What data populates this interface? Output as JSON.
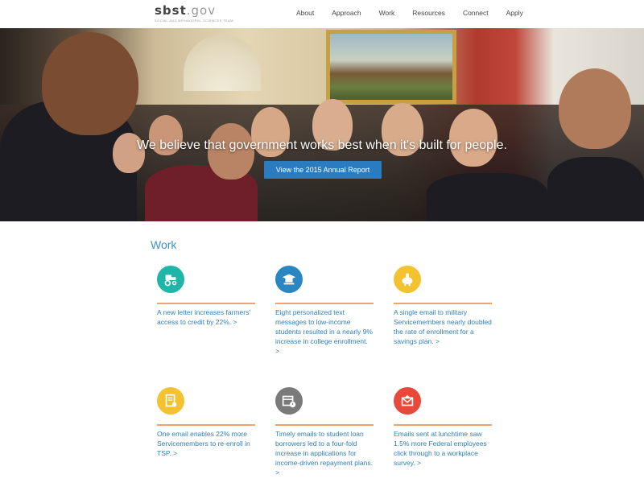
{
  "header": {
    "logo_main": "sbst",
    "logo_suffix": ".gov",
    "logo_sub": "Social and Behavioral Sciences Team",
    "nav": [
      "About",
      "Approach",
      "Work",
      "Resources",
      "Connect",
      "Apply"
    ]
  },
  "hero": {
    "tagline": "We believe that government works best when it's built for people.",
    "cta": "View the 2015 Annual Report"
  },
  "work": {
    "title": "Work",
    "cards": [
      {
        "icon": "tractor-icon",
        "color": "#1fb5a8",
        "text": "A new letter increases farmers' access to credit by 22%. >"
      },
      {
        "icon": "graduation-icon",
        "color": "#2a86c0",
        "text": "Eight personalized text messages to low-income students resulted in a nearly 9% increase in college enrollment. >"
      },
      {
        "icon": "piggy-bank-icon",
        "color": "#f2c230",
        "text": "A single email to military Servicemembers nearly doubled the rate of enrollment for a savings plan. >"
      },
      {
        "icon": "document-icon",
        "color": "#f2c230",
        "text": "One email enables 22% more Servicemembers to re-enroll in TSP. >"
      },
      {
        "icon": "calendar-clock-icon",
        "color": "#7a7a7a",
        "text": "Timely emails to student loan borrowers led to a four-fold increase in applications for income-driven repayment plans. >"
      },
      {
        "icon": "email-icon",
        "color": "#e8493a",
        "text": "Emails sent at lunchtime saw 1.5% more Federal employees click through to a workplace survey. >"
      }
    ]
  }
}
